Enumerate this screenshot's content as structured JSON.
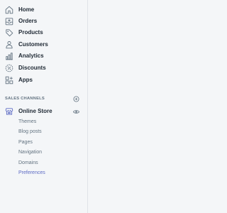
{
  "nav": {
    "items": [
      {
        "label": "Home",
        "icon": "home-icon"
      },
      {
        "label": "Orders",
        "icon": "orders-icon"
      },
      {
        "label": "Products",
        "icon": "products-icon"
      },
      {
        "label": "Customers",
        "icon": "customers-icon"
      },
      {
        "label": "Analytics",
        "icon": "analytics-icon"
      },
      {
        "label": "Discounts",
        "icon": "discounts-icon"
      },
      {
        "label": "Apps",
        "icon": "apps-icon"
      }
    ]
  },
  "sales_channels": {
    "title": "SALES CHANNELS",
    "add_icon": "plus-circle-icon",
    "store": {
      "label": "Online Store",
      "icon": "online-store-icon",
      "view_icon": "eye-icon",
      "sub_items": [
        {
          "label": "Themes"
        },
        {
          "label": "Blog posts"
        },
        {
          "label": "Pages"
        },
        {
          "label": "Navigation"
        },
        {
          "label": "Domains"
        },
        {
          "label": "Preferences",
          "active": true
        }
      ]
    }
  },
  "colors": {
    "text": "#212b36",
    "muted": "#637381",
    "accent": "#5c6ac4",
    "background": "#f4f6f8",
    "border": "#dfe3e8"
  }
}
